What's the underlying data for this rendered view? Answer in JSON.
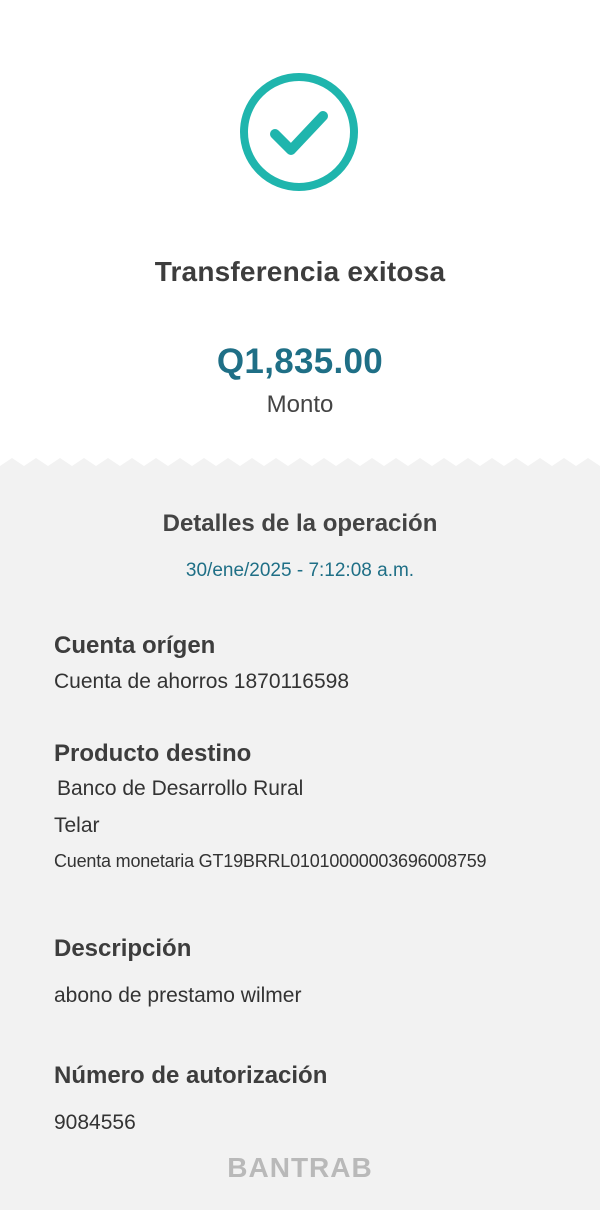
{
  "header": {
    "status_icon": "check-circle-icon",
    "title": "Transferencia exitosa",
    "amount": "Q1,835.00",
    "amount_label": "Monto"
  },
  "details": {
    "section_title": "Detalles de la operación",
    "datetime": "30/ene/2025 - 7:12:08 a.m.",
    "origin": {
      "label": "Cuenta orígen",
      "value": "Cuenta de ahorros 1870116598"
    },
    "destination": {
      "label": "Producto destino",
      "bank": "Banco de Desarrollo Rural",
      "name": "Telar",
      "account": "Cuenta monetaria GT19BRRL01010000003696008759"
    },
    "description": {
      "label": "Descripción",
      "value": "abono de prestamo wilmer"
    },
    "authorization": {
      "label": "Número de autorización",
      "value": "9084556"
    }
  },
  "footer": {
    "brand": "BANTRAB"
  },
  "colors": {
    "accent_teal": "#1fb5ad",
    "amount_blue": "#1f6f86",
    "details_background": "#f2f2f2",
    "brand_gray": "#b9b9b9"
  }
}
